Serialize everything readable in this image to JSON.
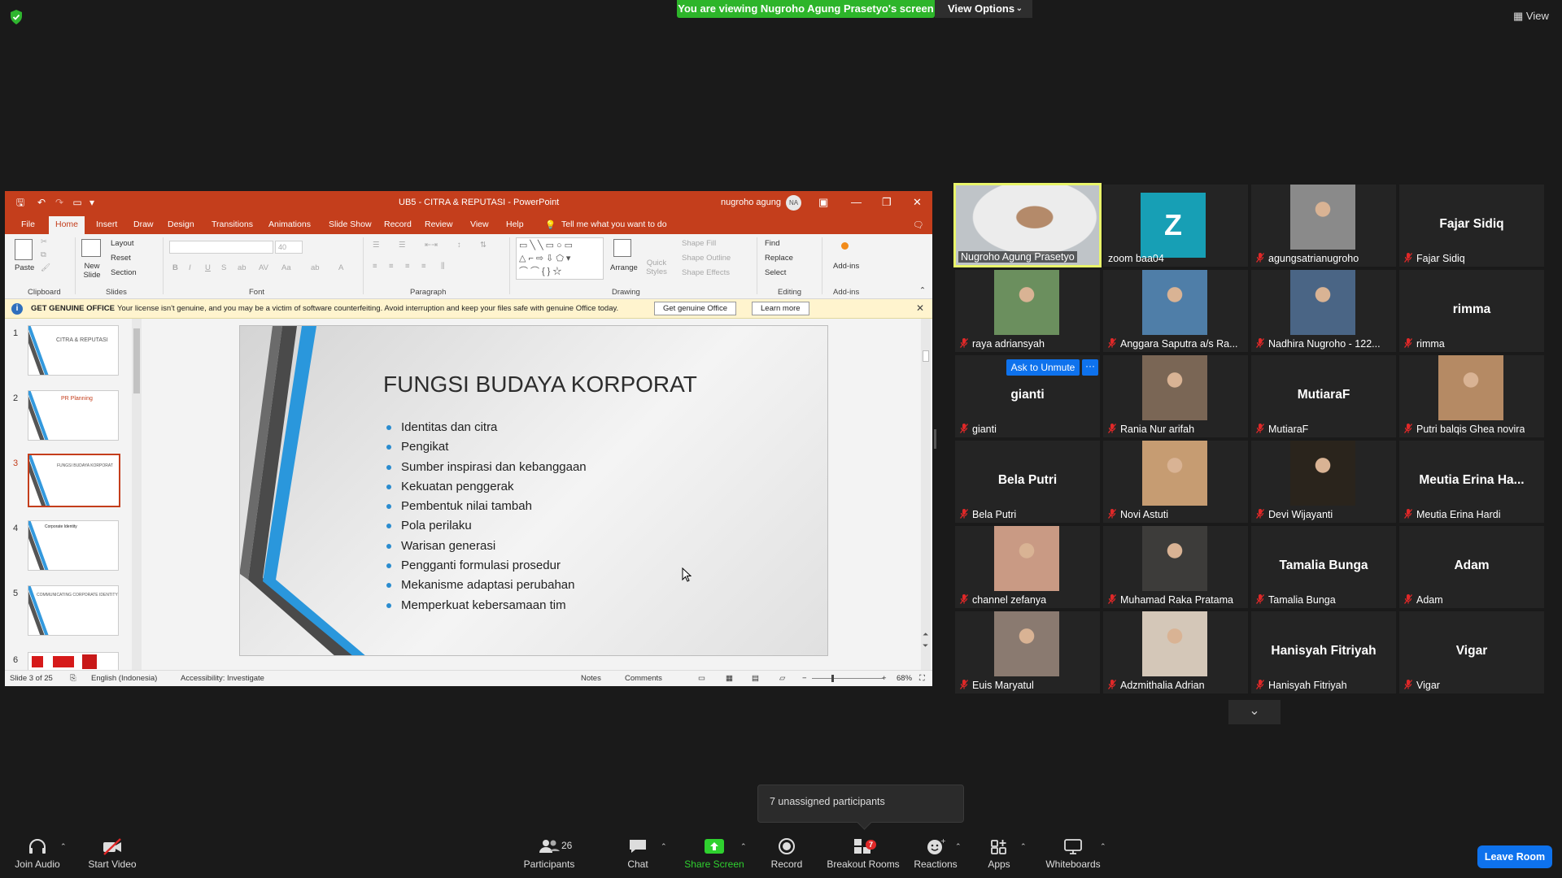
{
  "zoom": {
    "banner": "You are viewing Nugroho Agung Prasetyo's screen",
    "view_options": "View Options",
    "view_top_right": "View",
    "unassigned": "7 unassigned participants",
    "ask_to_unmute": "Ask to Unmute",
    "more": "···",
    "colors": {
      "accent": "#0e72ed",
      "green": "#2db52a",
      "active_speaker": "#e9f56a",
      "muted_mic": "#e02828"
    }
  },
  "ppt": {
    "window_title": "UB5 - CITRA & REPUTASI - PowerPoint",
    "user": "nugroho agung",
    "avatar": "NA",
    "tabs": [
      "File",
      "Home",
      "Insert",
      "Draw",
      "Design",
      "Transitions",
      "Animations",
      "Slide Show",
      "Record",
      "Review",
      "View",
      "Help"
    ],
    "tell_me": "Tell me what you want to do",
    "ribbon": {
      "clipboard": {
        "label": "Clipboard",
        "paste": "Paste"
      },
      "slides": {
        "label": "Slides",
        "new_slide": "New Slide",
        "layout": "Layout",
        "reset": "Reset",
        "section": "Section"
      },
      "font": {
        "label": "Font",
        "size": "40"
      },
      "paragraph": {
        "label": "Paragraph"
      },
      "drawing": {
        "label": "Drawing",
        "arrange": "Arrange",
        "quick_styles": "Quick Styles",
        "shape_fill": "Shape Fill",
        "shape_outline": "Shape Outline",
        "shape_effects": "Shape Effects"
      },
      "editing": {
        "label": "Editing",
        "find": "Find",
        "replace": "Replace",
        "select": "Select"
      },
      "addins": {
        "label": "Add-ins",
        "addins_btn": "Add-ins"
      }
    },
    "license": {
      "head": "GET GENUINE OFFICE",
      "message": "Your license isn't genuine, and you may be a victim of software counterfeiting. Avoid interruption and keep your files safe with genuine Office today.",
      "get_genuine": "Get genuine Office",
      "learn_more": "Learn more"
    },
    "thumbnails": [
      {
        "num": "1",
        "text": "CITRA & REPUTASI"
      },
      {
        "num": "2",
        "text": "PR Planning"
      },
      {
        "num": "3",
        "text": "FUNGSI BUDAYA KORPORAT"
      },
      {
        "num": "4",
        "text": "Corporate Identity"
      },
      {
        "num": "5",
        "text": "COMMUNICATING CORPORATE IDENTITY"
      },
      {
        "num": "6",
        "text": ""
      }
    ],
    "slide": {
      "title": "FUNGSI BUDAYA KORPORAT",
      "bullets": [
        "Identitas dan citra",
        "Pengikat",
        "Sumber inspirasi dan kebanggaan",
        "Kekuatan penggerak",
        "Pembentuk nilai tambah",
        "Pola perilaku",
        "Warisan generasi",
        "Pengganti formulasi prosedur",
        "Mekanisme adaptasi perubahan",
        "Memperkuat kebersamaan tim"
      ]
    },
    "status": {
      "slide_of": "Slide 3 of 25",
      "language": "English (Indonesia)",
      "accessibility": "Accessibility: Investigate",
      "notes": "Notes",
      "comments": "Comments",
      "zoom": "68%"
    }
  },
  "participants": [
    {
      "name": "Nugroho Agung Prasetyo",
      "big": "",
      "muted": false,
      "video": "photo",
      "active": true
    },
    {
      "name": "zoom baa04",
      "big": "Z",
      "muted": false,
      "video": "avatar"
    },
    {
      "name": "agungsatrianugroho",
      "big": "",
      "muted": true,
      "video": "photo"
    },
    {
      "name": "Fajar Sidiq",
      "big": "Fajar Sidiq",
      "muted": true,
      "video": "none"
    },
    {
      "name": "raya adriansyah",
      "big": "",
      "muted": true,
      "video": "photo"
    },
    {
      "name": "Anggara Saputra a/s Ra...",
      "big": "",
      "muted": true,
      "video": "photo"
    },
    {
      "name": "Nadhira Nugroho - 122...",
      "big": "",
      "muted": true,
      "video": "photo"
    },
    {
      "name": "rimma",
      "big": "rimma",
      "muted": true,
      "video": "none"
    },
    {
      "name": "gianti",
      "big": "gianti",
      "muted": true,
      "video": "none"
    },
    {
      "name": "Rania Nur arifah",
      "big": "",
      "muted": true,
      "video": "photo"
    },
    {
      "name": "MutiaraF",
      "big": "MutiaraF",
      "muted": true,
      "video": "none"
    },
    {
      "name": "Putri balqis Ghea novira",
      "big": "",
      "muted": true,
      "video": "photo"
    },
    {
      "name": "Bela Putri",
      "big": "Bela Putri",
      "muted": true,
      "video": "none"
    },
    {
      "name": "Novi Astuti",
      "big": "",
      "muted": true,
      "video": "photo"
    },
    {
      "name": "Devi Wijayanti",
      "big": "",
      "muted": true,
      "video": "photo"
    },
    {
      "name": "Meutia Erina Hardi",
      "big": "Meutia Erina Ha...",
      "muted": true,
      "video": "none"
    },
    {
      "name": "channel zefanya",
      "big": "",
      "muted": true,
      "video": "photo"
    },
    {
      "name": "Muhamad Raka Pratama",
      "big": "",
      "muted": true,
      "video": "photo"
    },
    {
      "name": "Tamalia Bunga",
      "big": "Tamalia Bunga",
      "muted": true,
      "video": "none"
    },
    {
      "name": "Adam",
      "big": "Adam",
      "muted": true,
      "video": "none"
    },
    {
      "name": "Euis Maryatul",
      "big": "",
      "muted": true,
      "video": "photo"
    },
    {
      "name": "Adzmithalia Adrian",
      "big": "",
      "muted": true,
      "video": "photo"
    },
    {
      "name": "Hanisyah Fitriyah",
      "big": "Hanisyah Fitriyah",
      "muted": true,
      "video": "none"
    },
    {
      "name": "Vigar",
      "big": "Vigar",
      "muted": true,
      "video": "none"
    }
  ],
  "toolbar": {
    "join_audio": "Join Audio",
    "start_video": "Start Video",
    "participants": "Participants",
    "participants_count": "26",
    "chat": "Chat",
    "share_screen": "Share Screen",
    "record": "Record",
    "breakout_rooms": "Breakout Rooms",
    "breakout_badge": "7",
    "reactions": "Reactions",
    "apps": "Apps",
    "whiteboards": "Whiteboards",
    "leave_room": "Leave Room"
  }
}
